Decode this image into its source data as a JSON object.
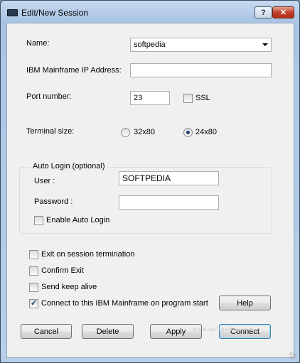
{
  "window": {
    "title": "Edit/New Session"
  },
  "form": {
    "name_label": "Name:",
    "name_value": "softpedia",
    "ip_label": "IBM Mainframe IP Address:",
    "ip_value": "",
    "port_label": "Port number:",
    "port_value": "23",
    "ssl_label": "SSL",
    "ssl_checked": false,
    "terminal_label": "Terminal size:",
    "terminal_options": [
      "32x80",
      "24x80"
    ],
    "terminal_selected": "24x80"
  },
  "auto_login": {
    "group_title": "Auto Login (optional)",
    "user_label": "User :",
    "user_value": "SOFTPEDIA",
    "password_label": "Password :",
    "password_value": "",
    "enable_label": "Enable Auto Login",
    "enable_checked": false
  },
  "options": [
    {
      "label": "Exit on session termination",
      "checked": false
    },
    {
      "label": "Confirm Exit",
      "checked": false
    },
    {
      "label": "Send keep alive",
      "checked": false
    },
    {
      "label": "Connect to this IBM Mainframe on program start",
      "checked": true
    }
  ],
  "buttons": {
    "help": "Help",
    "cancel": "Cancel",
    "delete": "Delete",
    "apply": "Apply",
    "connect": "Connect"
  },
  "watermark": "www.softpedia.com"
}
